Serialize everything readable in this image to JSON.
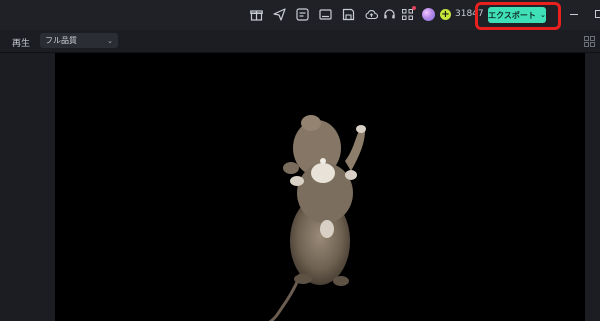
{
  "toolbar": {
    "icons": [
      "gift-icon",
      "send-icon",
      "media-icon",
      "subtitle-icon",
      "save-icon",
      "cloud-upload-icon",
      "headset-icon",
      "apps-icon"
    ],
    "credit_count": "31847",
    "export_label": "エクスポート",
    "accent_color": "#3fe0b8",
    "highlight_color": "#e8211e"
  },
  "player": {
    "label": "再生",
    "quality": "フル品質"
  }
}
